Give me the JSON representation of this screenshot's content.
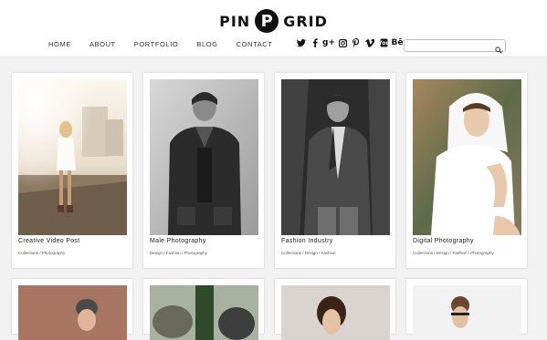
{
  "header": {
    "logo_left": "PIN",
    "logo_mark": "P",
    "logo_right": "GRID",
    "nav": [
      "HOME",
      "ABOUT",
      "PORTFOLIO",
      "BLOG",
      "CONTACT"
    ],
    "social_icons": [
      "twitter-icon",
      "facebook-icon",
      "google-plus-icon",
      "instagram-icon",
      "pinterest-icon",
      "vimeo-icon",
      "youtube-icon",
      "behance-icon"
    ],
    "search_value": ""
  },
  "posts": [
    {
      "title": "Creative Video Post",
      "tags": "Collections / Photography"
    },
    {
      "title": "Male Photography",
      "tags": "Design / Fashion / Photography"
    },
    {
      "title": "Fashion Industry",
      "tags": "Collections / Design / Fashion"
    },
    {
      "title": "Digital Photography",
      "tags": "Collections / Design / Fashion / Photography"
    }
  ]
}
